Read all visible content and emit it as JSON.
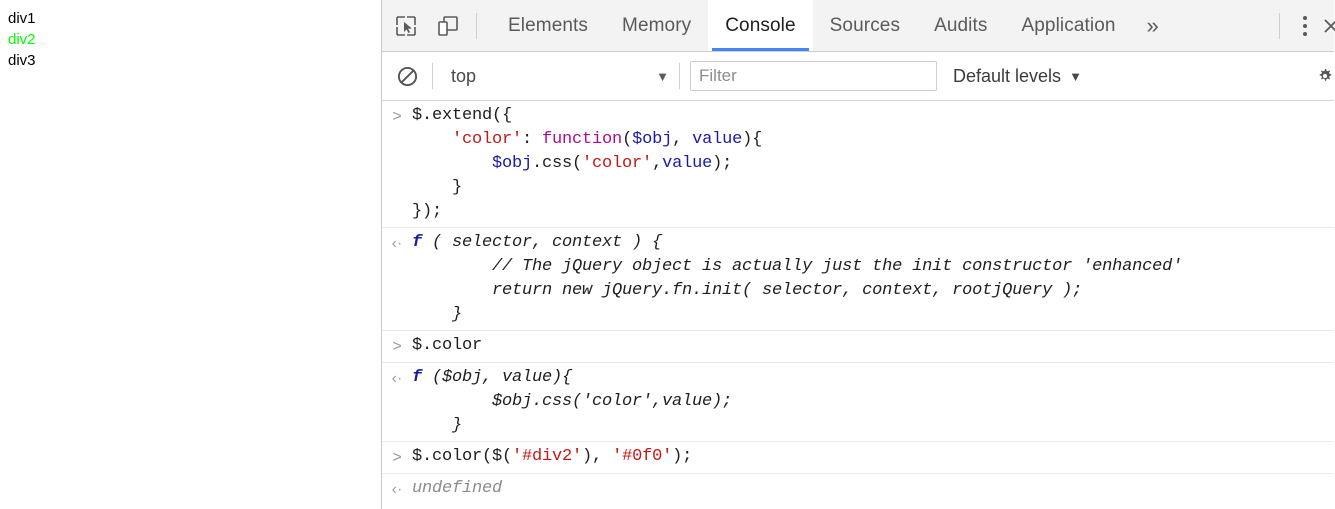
{
  "page_panel": {
    "lines": [
      {
        "text": "div1",
        "color": "#000000"
      },
      {
        "text": "div2",
        "color": "#00ff00"
      },
      {
        "text": "div3",
        "color": "#000000"
      }
    ]
  },
  "devtools": {
    "toolbar": {
      "inspect_icon": "inspect-element-icon",
      "device_icon": "device-toolbar-icon",
      "overflow_label": "»",
      "more_menu_icon": "kebab-menu-icon",
      "close_icon": "close-icon",
      "active_tab": "Console",
      "tabs": [
        {
          "label": "Elements"
        },
        {
          "label": "Memory"
        },
        {
          "label": "Console"
        },
        {
          "label": "Sources"
        },
        {
          "label": "Audits"
        },
        {
          "label": "Application"
        }
      ]
    },
    "filterbar": {
      "clear_icon": "clear-console-icon",
      "context": "top",
      "context_caret": "▼",
      "filter_value": "",
      "filter_placeholder": "Filter",
      "levels": "Default levels",
      "levels_caret": "▼",
      "settings_icon": "gear-icon"
    },
    "console": {
      "input_marker": ">",
      "response_marker": "‹·",
      "entries": [
        {
          "type": "input",
          "id": "entry-extend-input",
          "lines": [
            [
              {
                "t": "$.extend({",
                "c": "plain"
              }
            ],
            [
              {
                "t": "    ",
                "c": "plain"
              },
              {
                "t": "'color'",
                "c": "str"
              },
              {
                "t": ": ",
                "c": "plain"
              },
              {
                "t": "function",
                "c": "kw"
              },
              {
                "t": "(",
                "c": "plain"
              },
              {
                "t": "$obj",
                "c": "id"
              },
              {
                "t": ", ",
                "c": "plain"
              },
              {
                "t": "value",
                "c": "id"
              },
              {
                "t": "){",
                "c": "plain"
              }
            ],
            [
              {
                "t": "        ",
                "c": "plain"
              },
              {
                "t": "$obj",
                "c": "id"
              },
              {
                "t": ".css(",
                "c": "plain"
              },
              {
                "t": "'color'",
                "c": "str"
              },
              {
                "t": ",",
                "c": "plain"
              },
              {
                "t": "value",
                "c": "id"
              },
              {
                "t": ");",
                "c": "plain"
              }
            ],
            [
              {
                "t": "    }",
                "c": "plain"
              }
            ],
            [
              {
                "t": "});",
                "c": "plain"
              }
            ]
          ]
        },
        {
          "type": "response",
          "id": "entry-extend-response",
          "lines": [
            [
              {
                "t": "f",
                "c": "fn"
              },
              {
                "t": " ( selector, context ) {",
                "c": "plain"
              }
            ],
            [
              {
                "t": "        // The jQuery object is actually just the init constructor 'enhanced'",
                "c": "plain"
              }
            ],
            [
              {
                "t": "        return new jQuery.fn.init( selector, context, rootjQuery );",
                "c": "plain"
              }
            ],
            [
              {
                "t": "    }",
                "c": "plain"
              }
            ]
          ]
        },
        {
          "type": "input",
          "id": "entry-color-input",
          "lines": [
            [
              {
                "t": "$.color",
                "c": "plain"
              }
            ]
          ]
        },
        {
          "type": "response",
          "id": "entry-color-response",
          "lines": [
            [
              {
                "t": "f",
                "c": "fn"
              },
              {
                "t": " ($obj, value){",
                "c": "plain"
              }
            ],
            [
              {
                "t": "        $obj.css('color',value);",
                "c": "plain"
              }
            ],
            [
              {
                "t": "    }",
                "c": "plain"
              }
            ]
          ]
        },
        {
          "type": "input",
          "id": "entry-call-input",
          "lines": [
            [
              {
                "t": "$.color($(",
                "c": "plain"
              },
              {
                "t": "'#div2'",
                "c": "str"
              },
              {
                "t": "), ",
                "c": "plain"
              },
              {
                "t": "'#0f0'",
                "c": "str"
              },
              {
                "t": ");",
                "c": "plain"
              }
            ]
          ]
        },
        {
          "type": "response",
          "id": "entry-call-response",
          "lines": [
            [
              {
                "t": "undefined",
                "c": "dim"
              }
            ]
          ]
        }
      ]
    }
  }
}
